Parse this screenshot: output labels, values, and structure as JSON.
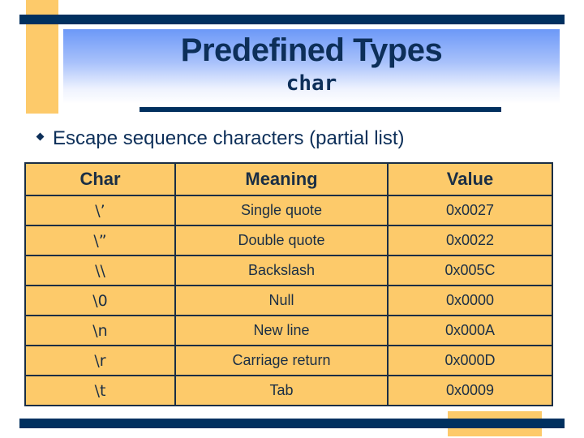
{
  "slide": {
    "title": "Predefined Types",
    "subtitle": "char",
    "bullet_text": "Escape sequence characters (partial list)"
  },
  "table": {
    "headers": [
      "Char",
      "Meaning",
      "Value"
    ],
    "rows": [
      {
        "char": "\\’",
        "meaning": "Single quote",
        "value": "0x0027"
      },
      {
        "char": "\\”",
        "meaning": "Double quote",
        "value": "0x0022"
      },
      {
        "char": "\\\\",
        "meaning": "Backslash",
        "value": "0x005C"
      },
      {
        "char": "\\0",
        "meaning": "Null",
        "value": "0x0000"
      },
      {
        "char": "\\n",
        "meaning": "New line",
        "value": "0x000A"
      },
      {
        "char": "\\r",
        "meaning": "Carriage return",
        "value": "0x000D"
      },
      {
        "char": "\\t",
        "meaning": "Tab",
        "value": "0x0009"
      }
    ]
  },
  "colors": {
    "navy": "#00305f",
    "gold": "#fdca6a",
    "text": "#0d2f59"
  }
}
